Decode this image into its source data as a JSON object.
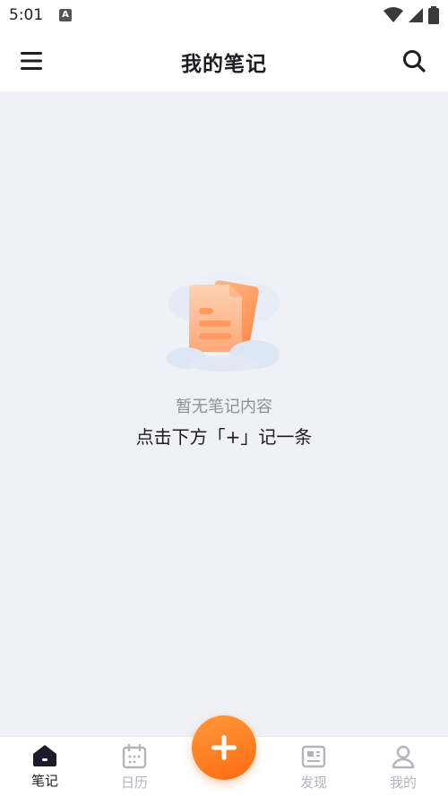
{
  "status": {
    "time": "5:01",
    "app_icon_letter": "A"
  },
  "app_bar": {
    "title": "我的笔记",
    "menu_icon": "hamburger-menu-icon",
    "search_icon": "search-icon"
  },
  "empty_state": {
    "title": "暂无笔记内容",
    "hint": "点击下方「+」记一条",
    "illustration": "empty-notes-illustration"
  },
  "tabs": [
    {
      "label": "笔记",
      "icon": "home-icon",
      "active": true
    },
    {
      "label": "日历",
      "icon": "calendar-icon",
      "active": false
    },
    {
      "label": "发现",
      "icon": "news-icon",
      "active": false
    },
    {
      "label": "我的",
      "icon": "person-icon",
      "active": false
    }
  ],
  "fab": {
    "icon": "plus-icon"
  },
  "colors": {
    "accent": "#ff7a1a",
    "background": "#f0f1f6",
    "surface": "#ffffff",
    "text_primary": "#1c1c1e",
    "text_muted": "#8e8e96",
    "tab_inactive": "#b4b4bc"
  }
}
